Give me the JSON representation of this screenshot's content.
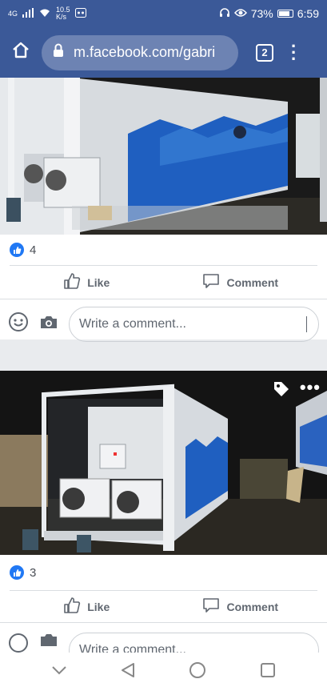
{
  "status_bar": {
    "network_type": "4G",
    "speed_value": "10.5",
    "speed_unit": "K/s",
    "battery_percent": "73%",
    "time": "6:59"
  },
  "browser": {
    "url": "m.facebook.com/gabri",
    "tab_count": "2"
  },
  "posts": [
    {
      "like_count": "4",
      "like_label": "Like",
      "comment_label": "Comment",
      "comment_placeholder": "Write a comment..."
    },
    {
      "like_count": "3",
      "like_label": "Like",
      "comment_label": "Comment",
      "comment_placeholder": "Write a comment..."
    }
  ],
  "icons": {
    "home": "home-icon",
    "lock": "lock-icon",
    "menu": "more-vertical-icon",
    "tag": "tag-icon",
    "more": "more-horizontal-icon",
    "emoji": "emoji-icon",
    "camera": "camera-icon"
  },
  "colors": {
    "facebook_blue": "#3b5998",
    "like_blue": "#2078f4",
    "container_wave": "#1f5fc0"
  },
  "battery_level": 0.73
}
